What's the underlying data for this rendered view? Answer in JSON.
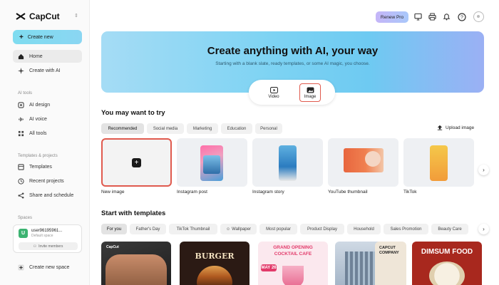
{
  "app": {
    "name": "CapCut"
  },
  "sidebar": {
    "create_new": "Create new",
    "nav": [
      {
        "label": "Home",
        "icon": "home-icon"
      },
      {
        "label": "Create with AI",
        "icon": "sparkle-icon"
      }
    ],
    "ai_tools_label": "AI tools",
    "ai_tools": [
      {
        "label": "AI design",
        "icon": "ai-design-icon"
      },
      {
        "label": "AI voice",
        "icon": "ai-voice-icon"
      },
      {
        "label": "All tools",
        "icon": "grid-icon"
      }
    ],
    "templates_label": "Templates & projects",
    "templates": [
      {
        "label": "Templates",
        "icon": "templates-icon"
      },
      {
        "label": "Recent projects",
        "icon": "clock-icon"
      },
      {
        "label": "Share and schedule",
        "icon": "share-icon"
      }
    ],
    "spaces_label": "Spaces",
    "space": {
      "avatar": "U",
      "name": "user96195961...",
      "sub": "Default space",
      "invite": "Invite members"
    },
    "create_space": "Create new space"
  },
  "topbar": {
    "renew": "Renew Pro"
  },
  "hero": {
    "title": "Create anything with AI, your way",
    "subtitle": "Starting with a blank slate, ready templates, or some AI magic, you choose.",
    "modes": [
      {
        "label": "Video"
      },
      {
        "label": "Image"
      }
    ]
  },
  "try": {
    "title": "You may want to try",
    "tabs": [
      "Recommended",
      "Social media",
      "Marketing",
      "Education",
      "Personal"
    ],
    "upload": "Upload image",
    "cards": [
      "New image",
      "Instagram post",
      "Instagram story",
      "YouTube thumbnail",
      "TikTok"
    ]
  },
  "templates": {
    "title": "Start with templates",
    "chips": [
      "For you",
      "Father's Day",
      "TikTok Thumbnail",
      "Wallpaper",
      "Most popular",
      "Product Display",
      "Household",
      "Sales Promotion",
      "Beauty Care"
    ],
    "cards": [
      {
        "line1": "CapCut"
      },
      {
        "line1": "BURGER"
      },
      {
        "line1": "GRAND OPENING",
        "line2": "COCKTAIL CAFE",
        "line3": "MAY 26"
      },
      {
        "line1": ""
      },
      {
        "line1": "CAPCUT",
        "line2": "COMPANY"
      },
      {
        "line1": "DIMSUM FOOD"
      }
    ]
  },
  "colors": {
    "accent": "#e05a4e",
    "hero_start": "#a5dcf5",
    "hero_end": "#9bb0f4"
  }
}
